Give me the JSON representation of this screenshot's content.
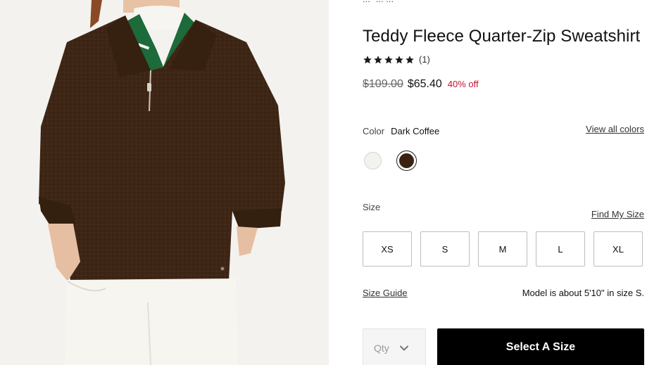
{
  "product": {
    "breadcrumb": "... ·... ...",
    "title": "Teddy Fleece Quarter-Zip Sweatshirt",
    "rating": {
      "stars": 5,
      "review_count": "(1)"
    },
    "price": {
      "original": "$109.00",
      "sale": "$65.40",
      "discount": "40% off"
    }
  },
  "color": {
    "label": "Color",
    "selected": "Dark Coffee",
    "view_all": "View all colors",
    "swatches": [
      {
        "name": "cream",
        "hex": "#f3f2ec",
        "selected": false
      },
      {
        "name": "Dark Coffee",
        "hex": "#3b2212",
        "selected": true
      }
    ]
  },
  "size": {
    "label": "Size",
    "find_my_size": "Find My Size",
    "options": [
      "XS",
      "S",
      "M",
      "L",
      "XL"
    ],
    "guide": "Size Guide",
    "model_note": "Model is about 5'10\" in size S."
  },
  "purchase": {
    "qty_label": "Qty",
    "cta": "Select A Size"
  },
  "colors": {
    "sale_red": "#c4122f",
    "cta_bg": "#000000",
    "fleece_brown": "#3e2616"
  }
}
